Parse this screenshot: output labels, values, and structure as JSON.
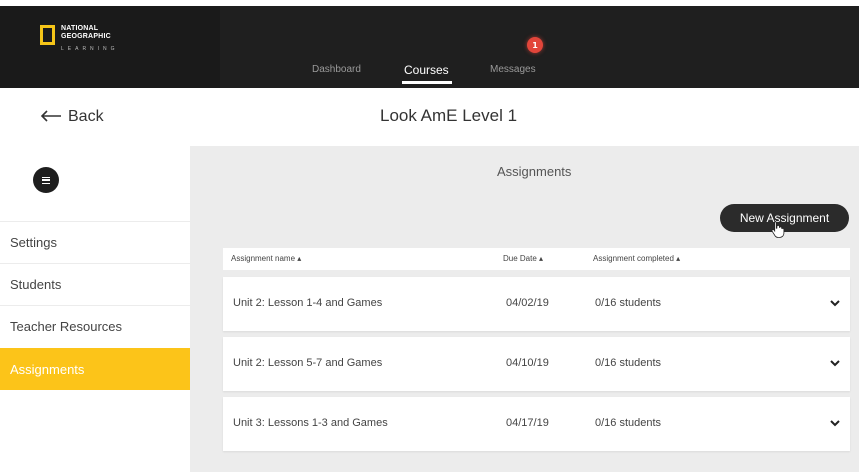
{
  "logo": {
    "line1": "NATIONAL",
    "line2": "GEOGRAPHIC",
    "line3": "LEARNING",
    "accent_color": "#f5c518"
  },
  "nav": {
    "items": [
      {
        "label": "Dashboard",
        "active": false
      },
      {
        "label": "Courses",
        "active": true
      },
      {
        "label": "Messages",
        "active": false
      }
    ],
    "messages_badge": "1",
    "badge_color": "#e2453a"
  },
  "header": {
    "back_label": "Back",
    "back_icon": "left-arrow-icon",
    "title": "Look AmE Level 1"
  },
  "sidebar": {
    "menu_icon": "hamburger-icon",
    "items": [
      {
        "label": "Settings",
        "active": false
      },
      {
        "label": "Students",
        "active": false
      },
      {
        "label": "Teacher Resources",
        "active": false
      },
      {
        "label": "Assignments",
        "active": true
      }
    ],
    "active_color": "#fcc419"
  },
  "main": {
    "section_title": "Assignments",
    "new_button_label": "New Assignment",
    "table": {
      "headers": [
        "Assignment name ▴",
        "Due Date ▴",
        "Assignment completed ▴"
      ],
      "rows": [
        {
          "name": "Unit 2: Lesson 1-4 and Games",
          "due": "04/02/19",
          "completed": "0/16 students"
        },
        {
          "name": "Unit 2: Lesson 5-7 and Games",
          "due": "04/10/19",
          "completed": "0/16 students"
        },
        {
          "name": "Unit 3: Lessons 1-3 and Games",
          "due": "04/17/19",
          "completed": "0/16 students"
        }
      ]
    }
  }
}
